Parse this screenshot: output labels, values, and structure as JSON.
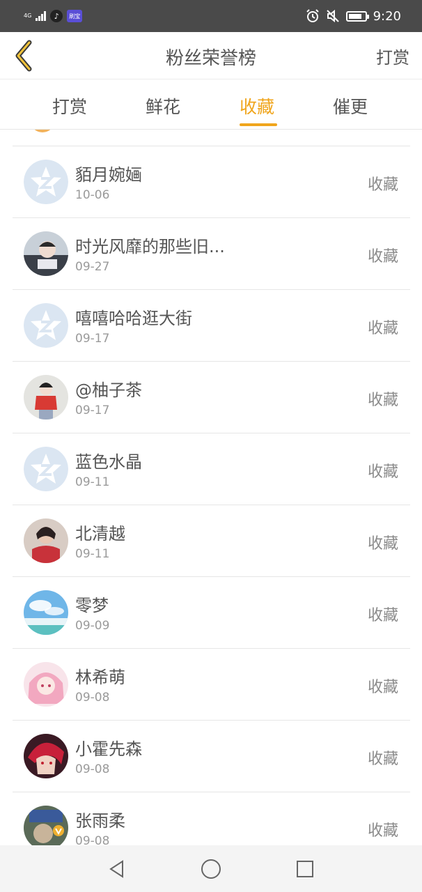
{
  "status_bar": {
    "network": "4G",
    "app_badge": "刷宝",
    "time": "9:20",
    "battery_level": 0.85
  },
  "header": {
    "title": "粉丝荣誉榜",
    "action_label": "打赏"
  },
  "tabs": [
    {
      "label": "打赏",
      "active": false
    },
    {
      "label": "鲜花",
      "active": false
    },
    {
      "label": "收藏",
      "active": true
    },
    {
      "label": "催更",
      "active": false
    }
  ],
  "colors": {
    "accent": "#f0a51c",
    "status_bar": "#4a4a4a",
    "text": "#555555",
    "muted": "#9a9a9a"
  },
  "fans": [
    {
      "name": "貊月婉婳",
      "date": "10-06",
      "action": "收藏",
      "avatar": "default-qq-icon"
    },
    {
      "name": "时光风靡的那些旧...",
      "date": "09-27",
      "action": "收藏",
      "avatar": "photo-avatar"
    },
    {
      "name": "嘻嘻哈哈逛大街",
      "date": "09-17",
      "action": "收藏",
      "avatar": "default-qq-icon"
    },
    {
      "name": "@柚子茶",
      "date": "09-17",
      "action": "收藏",
      "avatar": "photo-avatar"
    },
    {
      "name": "蓝色水晶",
      "date": "09-11",
      "action": "收藏",
      "avatar": "default-qq-icon"
    },
    {
      "name": "北清越",
      "date": "09-11",
      "action": "收藏",
      "avatar": "photo-avatar"
    },
    {
      "name": "零梦",
      "date": "09-09",
      "action": "收藏",
      "avatar": "sky-photo-avatar"
    },
    {
      "name": "林希萌",
      "date": "09-08",
      "action": "收藏",
      "avatar": "anime-avatar"
    },
    {
      "name": "小霍先森",
      "date": "09-08",
      "action": "收藏",
      "avatar": "anime-avatar"
    },
    {
      "name": "张雨柔",
      "date": "09-08",
      "action": "收藏",
      "avatar": "photo-avatar"
    }
  ],
  "system_nav": [
    "back-triangle-icon",
    "home-circle-icon",
    "recents-square-icon"
  ]
}
